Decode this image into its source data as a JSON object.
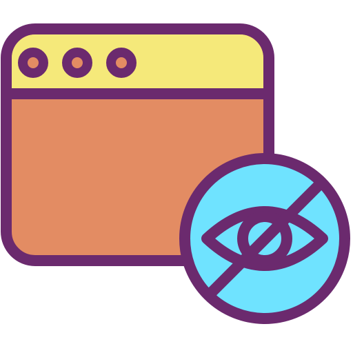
{
  "icon": {
    "name": "browser-window-hidden-icon",
    "colors": {
      "outline": "#6b2a6e",
      "titlebar": "#f5e97a",
      "window_body": "#e38c63",
      "badge_fill": "#6fe3ff",
      "dot_fill": "#e38c63"
    },
    "parts": {
      "window": "browser-window",
      "dots": [
        "window-dot",
        "window-dot",
        "window-dot"
      ],
      "badge": "hidden-eye-badge",
      "eye": "eye-icon",
      "slash": "slash"
    }
  }
}
